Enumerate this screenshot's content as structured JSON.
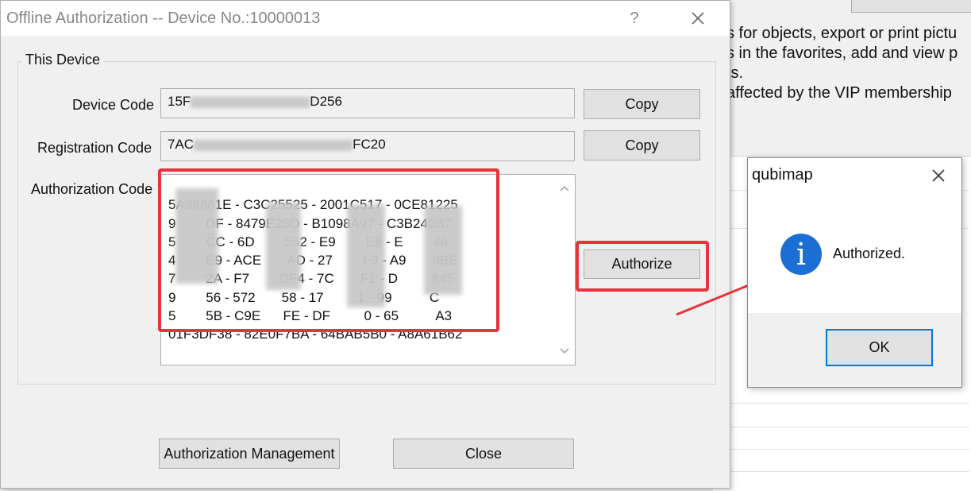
{
  "background": {
    "lines": [
      "s for objects, export or print pictu",
      "s in the favorites, add and view p",
      "ts.",
      "affected by the VIP membership"
    ]
  },
  "dialog": {
    "title": "Offline Authorization -- Device No.:10000013",
    "help_label": "?",
    "group_label": "This Device",
    "device_code_label": "Device Code",
    "device_code_prefix": "15F",
    "device_code_suffix": "D256",
    "registration_code_label": "Registration Code",
    "registration_code_prefix": "7AC",
    "registration_code_suffix": "FC20",
    "copy_label": "Copy",
    "authorization_code_label": "Authorization Code",
    "authorization_code_lines": [
      "5A98861E - C3C25525 - 2001C517 - 0CE81225",
      "9        DF - 8479E26D - B1098A97 - C3B240B7",
      "5        CC - 6D        552 - E9        E8 - E        46",
      "4        E9 - ACE       AD - 27        F9 - A9       9BE",
      "7        2A - F7        DF4 - 7C       F1 - D         845",
      "9        56 - 572       58 - 17         1 - 99          C",
      "5        5B - C9E      FE - DF         0 - 65          A3",
      "01F3DF38 - 82E0F7BA - 64BAB5B0 - A8A61B62"
    ],
    "authorize_label": "Authorize",
    "management_label": "Authorization Management",
    "close_label": "Close"
  },
  "message_box": {
    "title": "qubimap",
    "message": "Authorized.",
    "icon": "info-icon",
    "ok_label": "OK"
  },
  "colors": {
    "annotation_red": "#e8323c",
    "info_blue": "#1b6fd4",
    "focus_blue": "#0078d7"
  }
}
